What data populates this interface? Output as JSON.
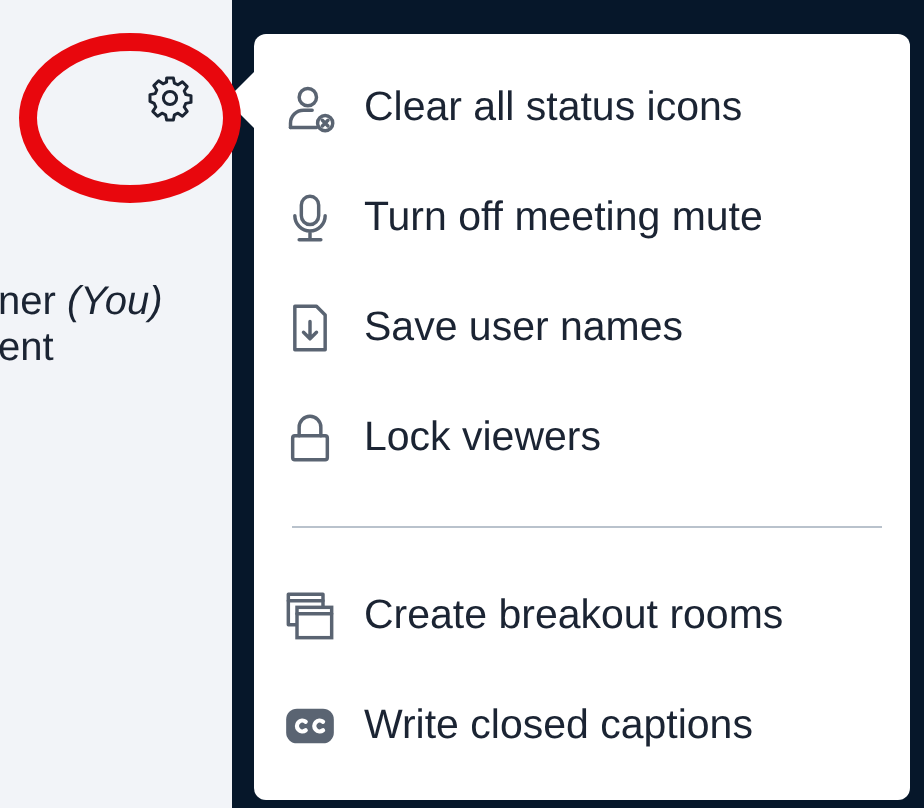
{
  "sidebar": {
    "items": [
      "ner *(You)*",
      "ent"
    ]
  },
  "menu": {
    "sections": [
      {
        "items": [
          "Clear all status icons",
          "Turn off meeting mute",
          "Save user names",
          "Lock viewers"
        ]
      },
      {
        "items": [
          "Create breakout rooms",
          "Write closed captions"
        ]
      }
    ]
  }
}
